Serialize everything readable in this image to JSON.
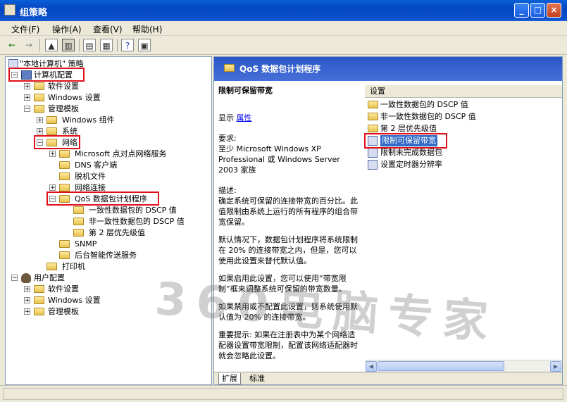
{
  "window": {
    "title": "组策略",
    "minimize": "_",
    "maximize": "□",
    "close": "×"
  },
  "menu": [
    "文件(F)",
    "操作(A)",
    "查看(V)",
    "帮助(H)"
  ],
  "tree": {
    "root": "\"本地计算机\" 策略",
    "computer_config": "计算机配置",
    "software_settings": "软件设置",
    "windows_settings": "Windows 设置",
    "admin_templates": "管理模板",
    "windows_components": "Windows 组件",
    "system": "系统",
    "network": "网络",
    "ms_p2p": "Microsoft 点对点网络服务",
    "dns_client": "DNS 客户端",
    "offline_files": "脱机文件",
    "net_connections": "网络连接",
    "qos": "QoS 数据包计划程序",
    "dscp_conforming": "一致性数据包的 DSCP 值",
    "dscp_nonconforming": "非一致性数据包的 DSCP 值",
    "layer2": "第 2 层优先级值",
    "snmp": "SNMP",
    "bits": "后台智能传送服务",
    "printers": "打印机",
    "user_config": "用户配置",
    "u_software_settings": "软件设置",
    "u_windows_settings": "Windows 设置",
    "u_admin_templates": "管理模板"
  },
  "right": {
    "header": "QoS 数据包计划程序",
    "desc_title": "限制可保留带宽",
    "display_label": "显示",
    "display_link": "属性",
    "req_label": "要求:",
    "req_text": "至少 Microsoft Windows XP Professional 或 Windows Server 2003 家族",
    "desc_label": "描述:",
    "desc_p1": "确定系统可保留的连接带宽的百分比。此值限制由系统上运行的所有程序的组合带宽保留。",
    "desc_p2": "默认情况下，数据包计划程序将系统限制在 20% 的连接带宽之内，但是，您可以使用此设置来替代默认值。",
    "desc_p3": "如果启用此设置，您可以使用“带宽限制”框来调整系统可保留的带宽数量。",
    "desc_p4": "如果禁用或不配置此设置，则系统使用默认值为 20% 的连接带宽。",
    "desc_p5": "重要提示: 如果在注册表中为某个网络适配器设置带宽限制，配置该网络适配器时就会忽略此设置。",
    "settings_header": "设置",
    "items": [
      "一致性数据包的 DSCP 值",
      "非一致性数据包的 DSCP 值",
      "第 2 层优先级值",
      "限制可保留带宽",
      "限制未完成数据包",
      "设置定时器分辨率"
    ],
    "tab_ext": "扩展",
    "tab_std": "标准"
  },
  "watermark": "360电脑专家"
}
